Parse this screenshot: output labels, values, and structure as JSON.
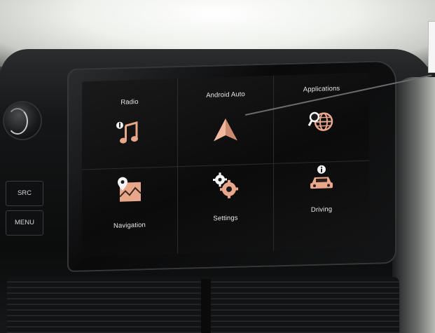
{
  "screen": {
    "tiles": [
      {
        "label": "Radio",
        "icon": "music-note-icon"
      },
      {
        "label": "Android Auto",
        "icon": "android-auto-arrow-icon"
      },
      {
        "label": "Applications",
        "icon": "globe-search-icon"
      },
      {
        "label": "Navigation",
        "icon": "map-pin-icon"
      },
      {
        "label": "Settings",
        "icon": "gears-icon"
      },
      {
        "label": "Driving",
        "icon": "car-info-icon"
      }
    ],
    "accent_color": "#e8a68a"
  },
  "hardware": {
    "src_label": "SRC",
    "menu_label": "MENU"
  }
}
